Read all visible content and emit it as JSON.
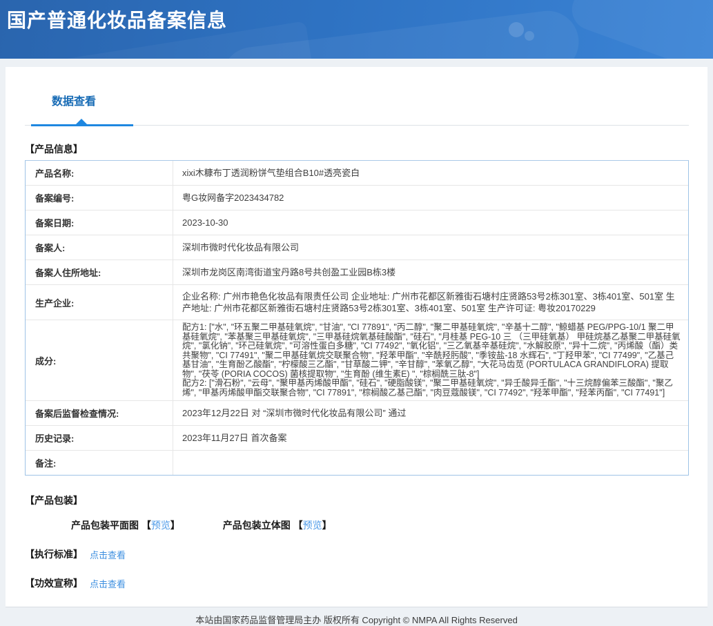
{
  "header": {
    "title": "国产普通化妆品备案信息"
  },
  "tabs": {
    "data_view": "数据查看"
  },
  "sections": {
    "product_info": "【产品信息】",
    "packaging": "【产品包装】",
    "standard": "【执行标准】",
    "claims": "【功效宣称】"
  },
  "product_table": {
    "rows": [
      {
        "label": "产品名称:",
        "value": "xixi木糠布丁透润粉饼气垫组合B10#透亮瓷白"
      },
      {
        "label": "备案编号:",
        "value": "粤G妆网备字2023434782"
      },
      {
        "label": "备案日期:",
        "value": "2023-10-30"
      },
      {
        "label": "备案人:",
        "value": "深圳市微时代化妆品有限公司"
      },
      {
        "label": "备案人住所地址:",
        "value": "深圳市龙岗区南湾街道宝丹路8号共创盈工业园B栋3楼"
      },
      {
        "label": "生产企业:",
        "value": "企业名称: 广州市艳色化妆品有限责任公司 企业地址: 广州市花都区新雅街石塘村庄贤路53号2栋301室、3栋401室、501室 生产地址: 广州市花都区新雅街石塘村庄贤路53号2栋301室、3栋401室、501室 生产许可证: 粤妆20170229"
      },
      {
        "label": "成分:",
        "value": "配方1: [\"水\", \"环五聚二甲基硅氧烷\", \"甘油\", \"CI 77891\", \"丙二醇\", \"聚二甲基硅氧烷\", \"辛基十二醇\", \"鲸蜡基 PEG/PPG-10/1 聚二甲基硅氧烷\", \"苯基聚三甲基硅氧烷\", \"三甲基硅烷氧基硅酸酯\", \"硅石\", \"月桂基 PEG-10 三 （三甲硅氧基） 甲硅烷基乙基聚二甲基硅氧烷\", \"氯化钠\", \"环己硅氧烷\", \"可溶性蛋白多糖\", \"CI 77492\", \"氧化铝\", \"三乙氧基辛基硅烷\", \"水解胶原\", \"异十二烷\", \"丙烯酸（酯）类共聚物\", \"CI 77491\", \"聚二甲基硅氧烷交联聚合物\", \"羟苯甲酯\", \"辛酰羟肟酸\", \"季铵盐-18 水辉石\", \"丁羟甲苯\", \"CI 77499\", \"乙基己基甘油\", \"生育酚乙酸酯\", \"柠檬酸三乙酯\", \"甘草酸二钾\", \"辛甘醇\", \"苯氧乙醇\", \"大花马齿苋 (PORTULACA GRANDIFLORA) 提取物\", \"茯苓 (PORIA COCOS) 菌核提取物\", \"生育酚 (维生素E) \", \"棕榈酰三肽-8\"]\n配方2: [\"滑石粉\", \"云母\", \"聚甲基丙烯酸甲酯\", \"硅石\", \"硬脂酸镁\", \"聚二甲基硅氧烷\", \"异壬酸异壬酯\", \"十三烷醇偏苯三酸酯\", \"聚乙烯\", \"甲基丙烯酸甲酯交联聚合物\", \"CI 77891\", \"棕榈酸乙基己酯\", \"肉豆蔻酸镁\", \"CI 77492\", \"羟苯甲酯\", \"羟苯丙酯\", \"CI 77491\"]"
      },
      {
        "label": "备案后监督检查情况:",
        "value": "2023年12月22日 对 “深圳市微时代化妆品有限公司” 通过"
      },
      {
        "label": "历史记录:",
        "value": "2023年11月27日 首次备案"
      },
      {
        "label": "备注:",
        "value": ""
      }
    ]
  },
  "packaging": {
    "flat_label": "产品包装平面图",
    "flat_bracket_open": "【",
    "flat_preview": "预览",
    "flat_bracket_close": "】",
    "solid_label": "产品包装立体图",
    "solid_bracket_open": "【",
    "solid_preview": "预览",
    "solid_bracket_close": "】"
  },
  "standard": {
    "link": "点击查看"
  },
  "claims": {
    "link": "点击查看"
  },
  "footer": {
    "text": "本站由国家药品监督管理局主办 版权所有 Copyright © NMPA All Rights Reserved"
  },
  "colors": {
    "banner_blue_start": "#2a65ae",
    "banner_blue_end": "#3b84d6",
    "tab_text": "#176bb5",
    "tab_underline": "#1e87e0",
    "link_blue": "#3d8fe0",
    "table_border": "#9ec3e6"
  }
}
